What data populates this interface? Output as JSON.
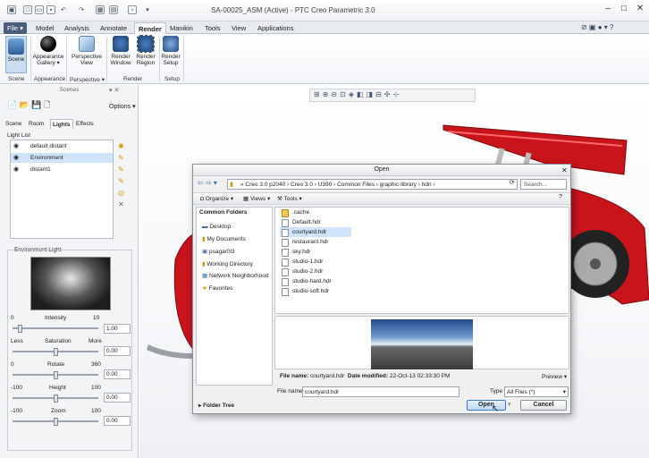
{
  "window": {
    "title": "SA-00025_ASM (Active) - PTC Creo Parametric 3.0"
  },
  "menu_tabs": [
    "File",
    "Model",
    "Analysis",
    "Annotate",
    "Render",
    "Manikin",
    "Tools",
    "View",
    "Applications"
  ],
  "active_tab": "Render",
  "ribbon": {
    "buttons": [
      {
        "label": "Scene"
      },
      {
        "label": "Appearance Gallery"
      },
      {
        "label": "Perspective View"
      },
      {
        "label": "Render Window"
      },
      {
        "label": "Render Region"
      },
      {
        "label": "Render Setup"
      }
    ],
    "groups": [
      "Scene",
      "Appearance",
      "Perspective",
      "Render",
      "Setup"
    ]
  },
  "scenes_panel": {
    "title": "Scenes",
    "options_label": "Options",
    "tabs": [
      "Scene",
      "Room",
      "Lights",
      "Effects"
    ],
    "active_tab": "Lights",
    "light_list_label": "Light List",
    "lights": [
      "default distant",
      "Environment",
      "distant1"
    ],
    "selected_light": "Environment",
    "env_light_label": "Environment Light",
    "intensity": {
      "label": "Intensity",
      "min": "0",
      "max": "10",
      "value": "1.00",
      "fraction": 0.1
    },
    "saturation": {
      "label": "Saturation",
      "min": "Less",
      "max": "More",
      "value": "0.00",
      "fraction": 0.5
    },
    "rotate": {
      "label": "Rotate",
      "min": "0",
      "max": "360",
      "value": "0.00",
      "fraction": 0.5
    },
    "height": {
      "label": "Height",
      "min": "-100",
      "max": "100",
      "value": "0.00",
      "fraction": 0.5
    },
    "zoom": {
      "label": "Zoom",
      "min": "-100",
      "max": "100",
      "value": "0.00",
      "fraction": 0.5
    }
  },
  "open_dialog": {
    "title": "Open",
    "breadcrumb": [
      "Creo 3.0 p2040",
      "Creo 3.0",
      "U390",
      "Common Files",
      "graphic-library",
      "hdri"
    ],
    "search_placeholder": "Search...",
    "organize_label": "Organize",
    "views_label": "Views",
    "tools_label": "Tools",
    "common_folders_label": "Common Folders",
    "common_folders": [
      "Desktop",
      "My Documents",
      "psagar0l3",
      "Working Directory",
      "Network Neighborhood",
      "Favorites"
    ],
    "files": [
      ".cache",
      "Default.hdr",
      "courtyard.hdr",
      "restaurant.hdr",
      "sky.hdr",
      "studio-1.hdr",
      "studio-2.hdr",
      "studio-hard.hdr",
      "studio-soft.hdr"
    ],
    "selected_file": "courtyard.hdr",
    "file_name_label": "File name:",
    "file_name_info": "courtyard.hdr",
    "date_modified_label": "Date modified:",
    "date_modified": "22-Oct-13 02:33:30 PM",
    "preview_label": "Preview",
    "filename_field_label": "File name:",
    "filename_value": "courtyard.hdr",
    "type_label": "Type",
    "type_value": "All Files (*)",
    "folder_tree_label": "Folder Tree",
    "open_label": "Open",
    "cancel_label": "Cancel"
  },
  "colors": {
    "accent": "#4a5d7a",
    "selection": "#cfe3fb",
    "car_red": "#c8141a"
  }
}
